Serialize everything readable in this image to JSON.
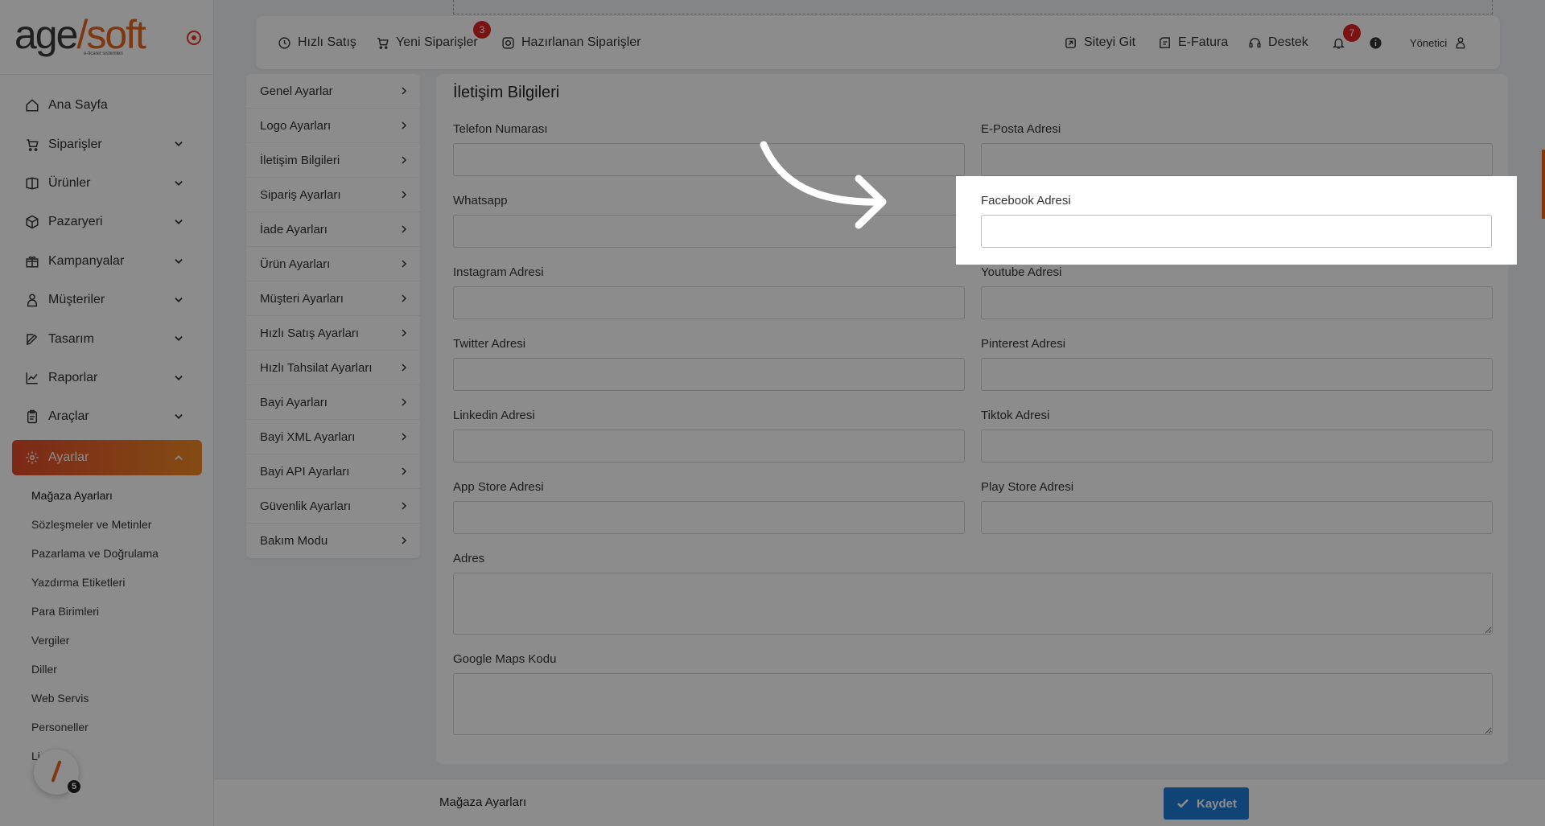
{
  "sidebar": {
    "logo_main": "age",
    "logo_soft": "soft",
    "logo_sub": "e-ticaret sistemleri",
    "items": [
      {
        "label": "Ana Sayfa",
        "icon": "home-icon"
      },
      {
        "label": "Siparişler",
        "icon": "cart-icon"
      },
      {
        "label": "Ürünler",
        "icon": "box-icon"
      },
      {
        "label": "Pazaryeri",
        "icon": "cube-icon"
      },
      {
        "label": "Kampanyalar",
        "icon": "gift-icon"
      },
      {
        "label": "Müşteriler",
        "icon": "user-icon"
      },
      {
        "label": "Tasarım",
        "icon": "edit-icon"
      },
      {
        "label": "Raporlar",
        "icon": "chart-icon"
      },
      {
        "label": "Araçlar",
        "icon": "clipboard-icon"
      },
      {
        "label": "Ayarlar",
        "icon": "gear-icon"
      }
    ],
    "submenu": [
      "Mağaza Ayarları",
      "Sözleşmeler ve Metinler",
      "Pazarlama ve Doğrulama",
      "Yazdırma Etiketleri",
      "Para Birimleri",
      "Vergiler",
      "Diller",
      "Web Servis",
      "Personeller",
      "Li"
    ],
    "fab_badge": "5"
  },
  "topbar": {
    "quick_sale": "Hızlı Satış",
    "new_orders": "Yeni Siparişler",
    "new_orders_badge": "3",
    "prepared_orders": "Hazırlanan Siparişler",
    "go_site": "Siteyi Git",
    "einvoice": "E-Fatura",
    "support": "Destek",
    "notif_badge": "7",
    "user": "Yönetici"
  },
  "settings_menu": [
    "Genel Ayarlar",
    "Logo Ayarları",
    "İletişim Bilgileri",
    "Sipariş Ayarları",
    "İade Ayarları",
    "Ürün Ayarları",
    "Müşteri Ayarları",
    "Hızlı Satış Ayarları",
    "Hızlı Tahsilat Ayarları",
    "Bayi Ayarları",
    "Bayi XML Ayarları",
    "Bayi API Ayarları",
    "Güvenlik Ayarları",
    "Bakım Modu"
  ],
  "form": {
    "title": "İletişim Bilgileri",
    "phone": "Telefon Numarası",
    "email": "E-Posta Adresi",
    "whatsapp": "Whatsapp",
    "facebook": "Facebook Adresi",
    "instagram": "Instagram Adresi",
    "youtube": "Youtube Adresi",
    "twitter": "Twitter Adresi",
    "pinterest": "Pinterest Adresi",
    "linkedin": "Linkedin Adresi",
    "tiktok": "Tiktok Adresi",
    "appstore": "App Store Adresi",
    "playstore": "Play Store Adresi",
    "address": "Adres",
    "maps": "Google Maps Kodu"
  },
  "bottombar": {
    "title": "Mağaza Ayarları",
    "save": "Kaydet"
  },
  "colors": {
    "accent": "#e8641d",
    "primary": "#1e7bd8",
    "badge": "#e02424"
  }
}
